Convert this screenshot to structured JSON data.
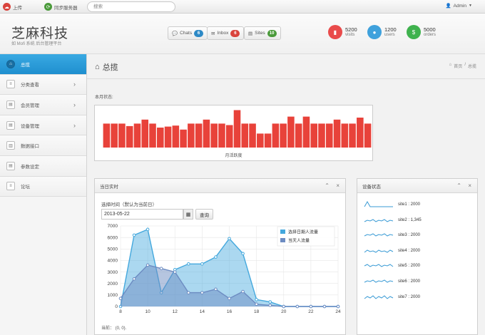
{
  "topbar": {
    "upload_label": "上传",
    "sync_label": "同步服务器",
    "search_placeholder": "搜索",
    "admin_label": "Admin"
  },
  "header": {
    "brand": "芝麻科技",
    "subtitle": "如 Mofi 系统 后台管理平台",
    "buttons": [
      {
        "label": "Chats",
        "count": "6",
        "color": "#2d89c6"
      },
      {
        "label": "Inbox",
        "count": "6",
        "color": "#d9433c"
      },
      {
        "label": "Sites",
        "count": "10",
        "color": "#4a9a3a"
      }
    ],
    "stats": [
      {
        "value": "5200",
        "label": "visits",
        "color": "#e94b4b"
      },
      {
        "value": "1200",
        "label": "users",
        "color": "#3fa1dc"
      },
      {
        "value": "5000",
        "label": "orders",
        "color": "#3fb24e"
      }
    ]
  },
  "sidebar": {
    "items": [
      {
        "label": "总揽",
        "has_chevron": false
      },
      {
        "label": "分类查看",
        "has_chevron": true
      },
      {
        "label": "会员管理",
        "has_chevron": true
      },
      {
        "label": "设备管理",
        "has_chevron": true
      },
      {
        "label": "数据接口",
        "has_chevron": false
      },
      {
        "label": "参数设定",
        "has_chevron": false
      },
      {
        "label": "论坛",
        "has_chevron": false
      }
    ]
  },
  "main": {
    "title": "总揽",
    "breadcrumb_home": "首页",
    "breadcrumb_sep": "/",
    "breadcrumb_current": "总揽",
    "month_status_label": "本月状态:",
    "month_chart_caption": "月活跃度"
  },
  "realtime": {
    "title": "当日实时",
    "date_label": "选择时间（默认为当前日）",
    "date_value": "2013-05-22",
    "query_label": "查询",
    "current_text": "当前： (0, 0)."
  },
  "device": {
    "title": "设备状态",
    "sites": [
      {
        "label": "site1 : 2000",
        "spark": [
          2,
          9,
          2,
          2,
          2,
          2,
          2,
          2,
          2,
          2,
          2
        ]
      },
      {
        "label": "site2 : 1,345",
        "spark": [
          3,
          5,
          4,
          6,
          3,
          5,
          4,
          6,
          3,
          5,
          4
        ]
      },
      {
        "label": "site3 : 2000",
        "spark": [
          4,
          6,
          5,
          7,
          4,
          6,
          5,
          7,
          4,
          6,
          5
        ]
      },
      {
        "label": "site4 : 2000",
        "spark": [
          3,
          6,
          4,
          5,
          3,
          6,
          4,
          5,
          3,
          6,
          4
        ]
      },
      {
        "label": "site5 : 2000",
        "spark": [
          5,
          7,
          4,
          6,
          5,
          7,
          4,
          6,
          5,
          7,
          4
        ]
      },
      {
        "label": "site6 : 2000",
        "spark": [
          4,
          6,
          5,
          7,
          4,
          6,
          5,
          7,
          4,
          6,
          5
        ]
      },
      {
        "label": "site7 : 2000",
        "spark": [
          3,
          6,
          4,
          7,
          3,
          6,
          4,
          7,
          3,
          6,
          4
        ]
      }
    ]
  },
  "chart_data": [
    {
      "type": "bar",
      "caption": "月活跃度",
      "values": [
        48,
        48,
        48,
        43,
        48,
        56,
        48,
        40,
        42,
        44,
        36,
        48,
        48,
        56,
        48,
        48,
        45,
        75,
        48,
        48,
        28,
        28,
        48,
        48,
        62,
        48,
        62,
        48,
        48,
        48,
        56,
        48,
        48,
        60,
        48
      ],
      "ylim": [
        0,
        80
      ],
      "color": "#e8423a"
    },
    {
      "type": "area",
      "x": [
        8,
        9,
        10,
        11,
        12,
        13,
        14,
        15,
        16,
        17,
        18,
        19,
        20,
        21,
        22,
        23,
        24
      ],
      "series": [
        {
          "name": "选择日期人流量",
          "color": "#44a8dd",
          "values": [
            0,
            6200,
            6700,
            1200,
            3200,
            3700,
            3700,
            4300,
            5900,
            4600,
            600,
            400,
            0,
            0,
            0,
            0,
            0
          ]
        },
        {
          "name": "当天人流量",
          "color": "#6d8cc2",
          "values": [
            700,
            2400,
            3600,
            3300,
            3000,
            1200,
            1200,
            1500,
            700,
            1300,
            200,
            100,
            0,
            0,
            0,
            0,
            0
          ]
        }
      ],
      "ylim": [
        0,
        7000
      ],
      "yticks": [
        0,
        1000,
        2000,
        3000,
        4000,
        5000,
        6000,
        7000
      ],
      "xticks": [
        8,
        10,
        12,
        14,
        16,
        18,
        20,
        22,
        24
      ]
    }
  ]
}
